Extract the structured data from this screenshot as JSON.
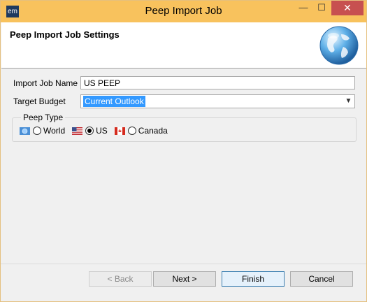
{
  "window": {
    "title": "Peep Import Job",
    "app_icon_text": "em"
  },
  "banner": {
    "title": "Peep Import Job Settings",
    "image": "globe-icon"
  },
  "form": {
    "job_name_label": "Import Job Name",
    "job_name_value": "US PEEP",
    "target_budget_label": "Target Budget",
    "target_budget_value": "Current Outlook",
    "peep_type": {
      "legend": "Peep Type",
      "options": [
        {
          "label": "World",
          "checked": false,
          "icon": "world-flag-icon"
        },
        {
          "label": "US",
          "checked": true,
          "icon": "us-flag-icon"
        },
        {
          "label": "Canada",
          "checked": false,
          "icon": "canada-flag-icon"
        }
      ]
    }
  },
  "buttons": {
    "back": "< Back",
    "next": "Next >",
    "finish": "Finish",
    "cancel": "Cancel"
  },
  "colors": {
    "titlebar": "#f8c25d",
    "close": "#c75050",
    "selection": "#3399ff"
  }
}
